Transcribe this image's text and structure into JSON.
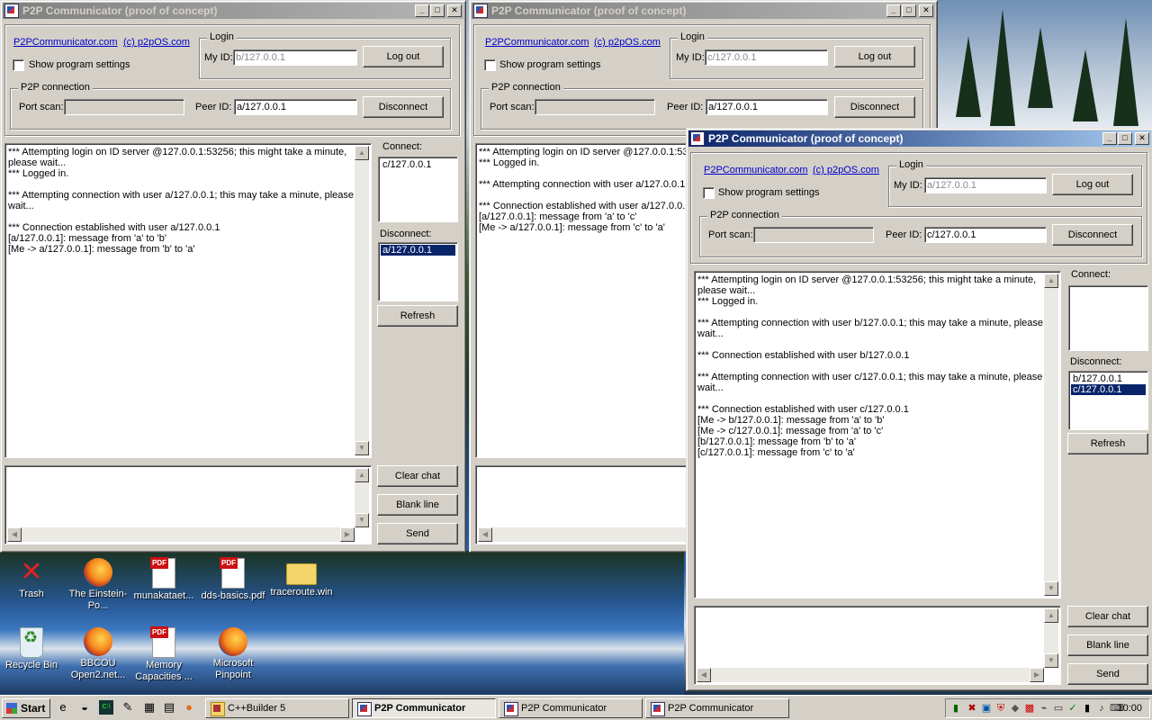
{
  "windows": [
    {
      "title": "P2P Communicator  (proof of concept)",
      "link1": "P2PCommunicator.com",
      "link2": "(c) p2pOS.com",
      "show_settings": "Show program settings",
      "login_group": "Login",
      "my_id_label": "My ID:",
      "my_id": "b/127.0.0.1",
      "logout": "Log out",
      "p2p_group": "P2P connection",
      "port_scan_label": "Port scan:",
      "peer_id_label": "Peer ID:",
      "peer_id": "a/127.0.0.1",
      "disconnect": "Disconnect",
      "chat": [
        "*** Attempting login on ID server @127.0.0.1:53256; this might take a minute, please wait...",
        "*** Logged in.",
        "",
        "*** Attempting connection with user a/127.0.0.1; this may take a minute, please wait...",
        "",
        "*** Connection established with user a/127.0.0.1",
        "[a/127.0.0.1]: message from 'a' to 'b'",
        "[Me -> a/127.0.0.1]: message from 'b' to 'a'"
      ],
      "connect_label": "Connect:",
      "connect_list": [
        "c/127.0.0.1"
      ],
      "disconnect_label": "Disconnect:",
      "disconnect_list": [
        "a/127.0.0.1"
      ],
      "refresh": "Refresh",
      "clear_chat": "Clear chat",
      "blank_line": "Blank line",
      "send": "Send"
    },
    {
      "title": "P2P Communicator  (proof of concept)",
      "link1": "P2PCommunicator.com",
      "link2": "(c) p2pOS.com",
      "show_settings": "Show program settings",
      "login_group": "Login",
      "my_id_label": "My ID:",
      "my_id": "c/127.0.0.1",
      "logout": "Log out",
      "p2p_group": "P2P connection",
      "port_scan_label": "Port scan:",
      "peer_id_label": "Peer ID:",
      "peer_id": "a/127.0.0.1",
      "disconnect": "Disconnect",
      "chat": [
        "*** Attempting login on ID server @127.0.0.1:53256; this might take a minute, please wait...",
        "*** Logged in.",
        "",
        "*** Attempting connection with user a/127.0.0.1; this may take a minute, please wait...",
        "",
        "*** Connection established with user a/127.0.0.1",
        "[a/127.0.0.1]: message from 'a' to 'c'",
        "[Me -> a/127.0.0.1]: message from 'c' to 'a'"
      ]
    },
    {
      "title": "P2P Communicator  (proof of concept)",
      "link1": "P2PCommunicator.com",
      "link2": "(c) p2pOS.com",
      "show_settings": "Show program settings",
      "login_group": "Login",
      "my_id_label": "My ID:",
      "my_id": "a/127.0.0.1",
      "logout": "Log out",
      "p2p_group": "P2P connection",
      "port_scan_label": "Port scan:",
      "peer_id_label": "Peer ID:",
      "peer_id": "c/127.0.0.1",
      "disconnect": "Disconnect",
      "chat": [
        "*** Attempting login on ID server @127.0.0.1:53256; this might take a minute, please wait...",
        "*** Logged in.",
        "",
        "*** Attempting connection with user b/127.0.0.1; this may take a minute, please wait...",
        "",
        "*** Connection established with user b/127.0.0.1",
        "",
        "*** Attempting connection with user c/127.0.0.1; this may take a minute, please wait...",
        "",
        "*** Connection established with user c/127.0.0.1",
        "[Me -> b/127.0.0.1]: message from 'a' to 'b'",
        "[Me -> c/127.0.0.1]: message from 'a' to 'c'",
        "[b/127.0.0.1]: message from 'b' to 'a'",
        "[c/127.0.0.1]: message from 'c' to 'a'"
      ],
      "connect_label": "Connect:",
      "connect_list": [],
      "disconnect_label": "Disconnect:",
      "disconnect_list": [
        "b/127.0.0.1",
        "c/127.0.0.1"
      ],
      "refresh": "Refresh",
      "clear_chat": "Clear chat",
      "blank_line": "Blank line",
      "send": "Send"
    }
  ],
  "desktop_icons": [
    {
      "label": "Trash",
      "icon": "trash-icon"
    },
    {
      "label": "The Einstein-Po...",
      "icon": "firefox-icon"
    },
    {
      "label": "munakataet...",
      "icon": "pdf-icon"
    },
    {
      "label": "dds-basics.pdf",
      "icon": "pdf-icon"
    },
    {
      "label": "traceroute.win",
      "icon": "folder-icon"
    },
    {
      "label": "Recycle Bin",
      "icon": "recycle-bin-icon"
    },
    {
      "label": "BBCOU Open2.net...",
      "icon": "firefox-icon"
    },
    {
      "label": "Memory Capacities ...",
      "icon": "pdf-icon"
    },
    {
      "label": "Microsoft Pinpoint",
      "icon": "firefox-icon"
    }
  ],
  "taskbar": {
    "start": "Start",
    "tasks": [
      "C++Builder 5",
      "P2P Communicator",
      "P2P Communicator",
      "P2P Communicator"
    ],
    "clock": "10:00"
  },
  "colors": {
    "titlebar_active": "#0a246a",
    "titlebar_inactive": "#808080",
    "face": "#d4d0c8",
    "selection": "#0a246a"
  }
}
